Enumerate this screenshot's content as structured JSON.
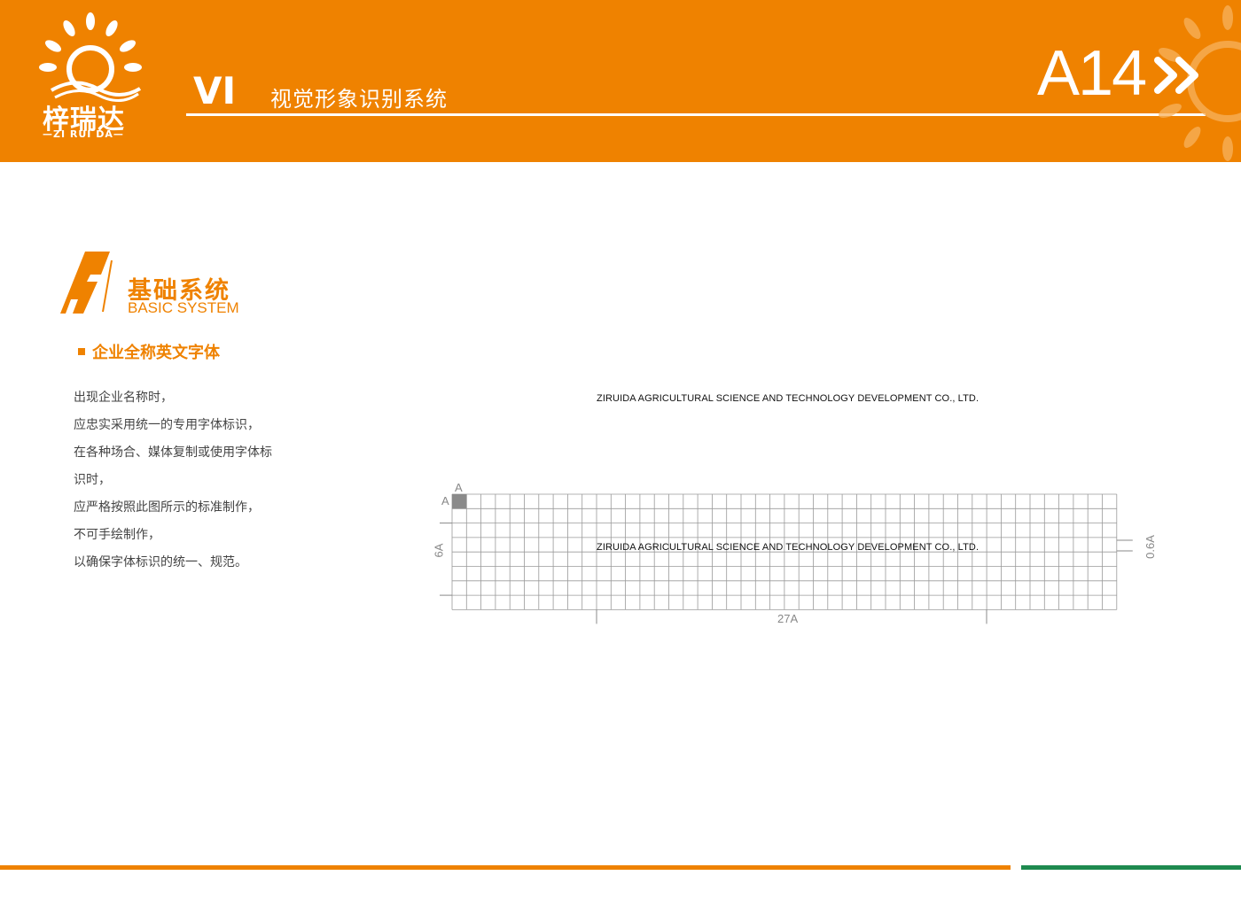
{
  "brand": {
    "logo_cn": "梓瑞达",
    "logo_en": "—ZI RUI DA—",
    "orange": "#ef8200",
    "green": "#1e8a4f"
  },
  "header": {
    "vi": "VI",
    "subtitle": "视觉形象识别系统",
    "page_number": "A14"
  },
  "section": {
    "letter": "A",
    "title_cn": "基础系统",
    "title_en": "BASIC SYSTEM"
  },
  "subsection": {
    "title": "企业全称英文字体"
  },
  "description": [
    "出现企业名称时，",
    "应忠实采用统一的专用字体标识，",
    "在各种场合、媒体复制或使用字体标",
    "识时，",
    "应严格按照此图所示的标准制作，",
    "不可手绘制作，",
    "以确保字体标识的统一、规范。"
  ],
  "specimen": {
    "company_name": "ZIRUIDA AGRICULTURAL SCIENCE AND TECHNOLOGY DEVELOPMENT CO., LTD.",
    "grid_company_name": "ZIRUIDA AGRICULTURAL SCIENCE AND TECHNOLOGY DEVELOPMENT CO., LTD.",
    "unit_label_top": "A",
    "unit_label_left": "A",
    "height_label": "6A",
    "letter_height_label": "0.6A",
    "width_label": "27A"
  }
}
